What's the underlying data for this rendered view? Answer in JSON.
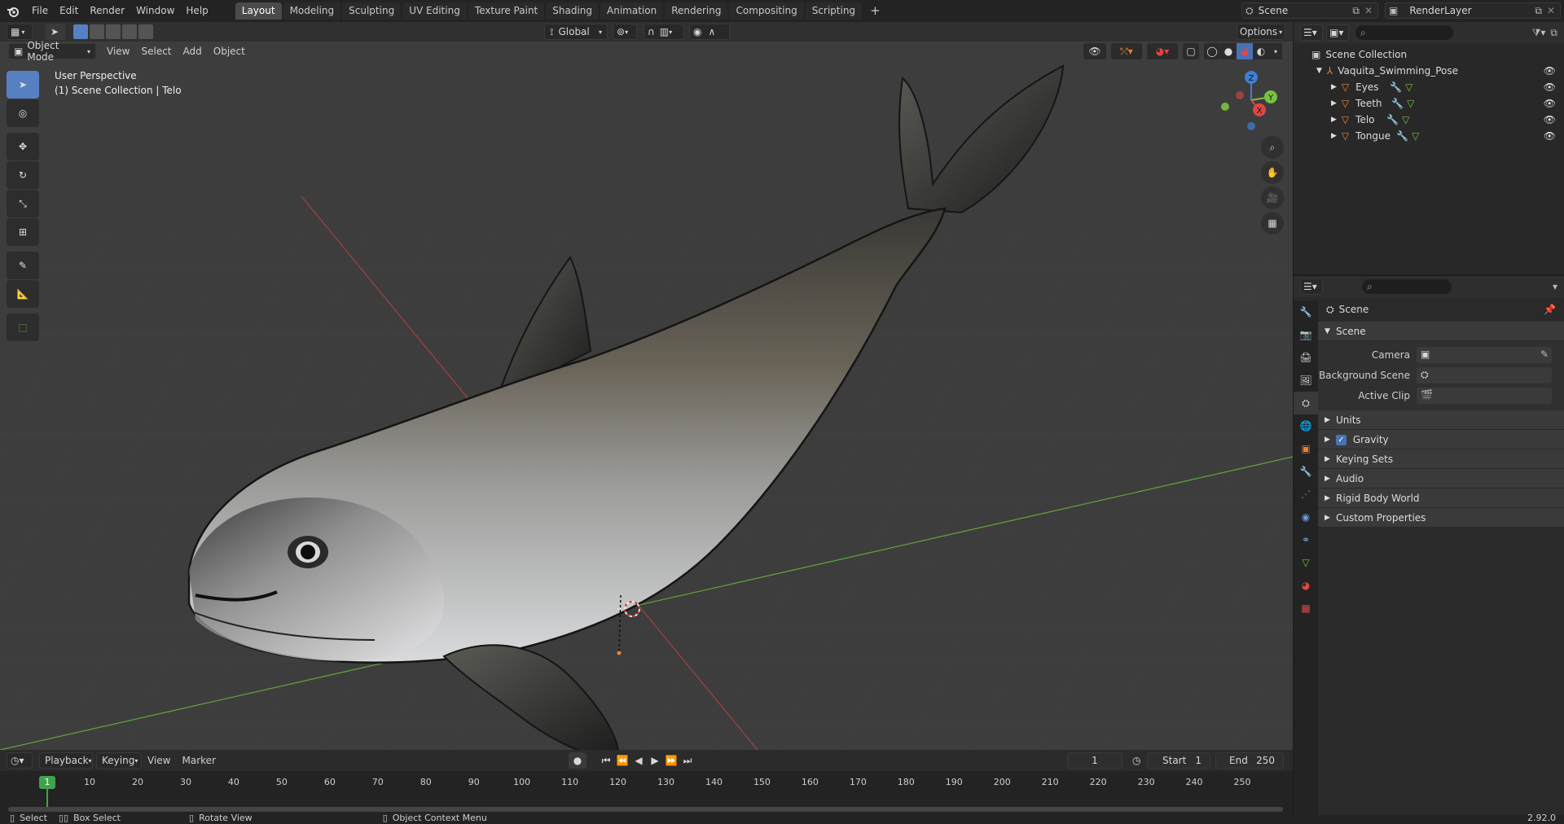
{
  "app": {
    "version": "2.92.0"
  },
  "topbar": {
    "menus": [
      "File",
      "Edit",
      "Render",
      "Window",
      "Help"
    ],
    "workspaces": [
      "Layout",
      "Modeling",
      "Sculpting",
      "UV Editing",
      "Texture Paint",
      "Shading",
      "Animation",
      "Rendering",
      "Compositing",
      "Scripting"
    ],
    "active_workspace": "Layout",
    "add_tab": "+",
    "scene": "Scene",
    "view_layer": "RenderLayer"
  },
  "viewport_header": {
    "mode": "Object Mode",
    "menus": [
      "View",
      "Select",
      "Add",
      "Object"
    ],
    "transform_orientation": "Global",
    "options": "Options"
  },
  "viewport": {
    "overlay_line1": "User Perspective",
    "overlay_line2": "(1) Scene Collection | Telo",
    "gizmo": {
      "z": "Z",
      "y": "Y",
      "x": "X"
    }
  },
  "outliner": {
    "root": "Scene Collection",
    "collection": "Vaquita_Swimming_Pose",
    "objects": [
      "Eyes",
      "Teeth",
      "Telo",
      "Tongue"
    ]
  },
  "properties": {
    "context": "Scene",
    "panel": "Scene",
    "fields": [
      "Camera",
      "Background Scene",
      "Active Clip"
    ],
    "subpanels": [
      "Units",
      "Gravity",
      "Keying Sets",
      "Audio",
      "Rigid Body World",
      "Custom Properties"
    ],
    "gravity_checked": true
  },
  "timeline": {
    "menus": [
      "Playback",
      "Keying",
      "View",
      "Marker"
    ],
    "current_frame": "1",
    "start_label": "Start",
    "start": "1",
    "end_label": "End",
    "end": "250",
    "ticks": [
      "1",
      "10",
      "20",
      "30",
      "40",
      "50",
      "60",
      "70",
      "80",
      "90",
      "100",
      "110",
      "120",
      "130",
      "140",
      "150",
      "160",
      "170",
      "180",
      "190",
      "200",
      "210",
      "220",
      "230",
      "240",
      "250"
    ]
  },
  "statusbar": {
    "select": "Select",
    "box_select": "Box Select",
    "rotate_view": "Rotate View",
    "context_menu": "Object Context Menu"
  },
  "colors": {
    "accent": "#4772b3",
    "object_orange": "#e8833a",
    "axis_red": "#e04545",
    "axis_green": "#7ac142",
    "frame_green": "#3fa34d"
  }
}
